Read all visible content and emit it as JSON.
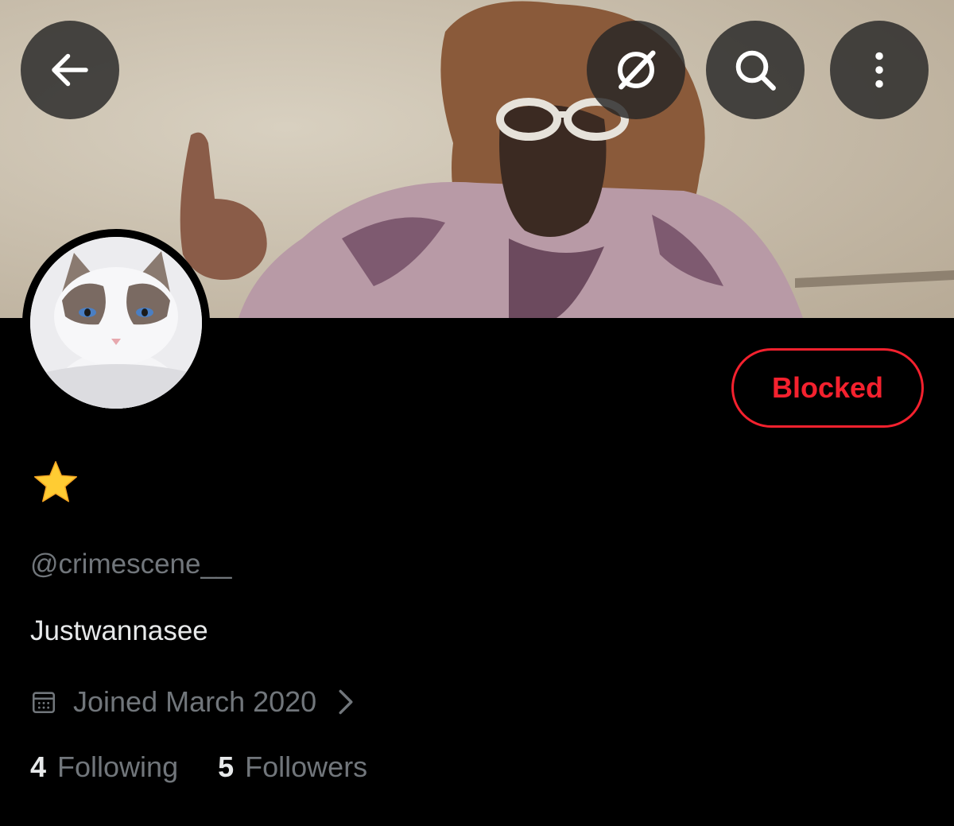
{
  "header": {
    "back_icon": "arrow-left-icon",
    "grok_icon": "grok-icon",
    "search_icon": "search-icon",
    "more_icon": "more-vertical-icon"
  },
  "profile": {
    "display_name_emoji": "⭐",
    "handle": "@crimescene__",
    "bio": "Justwannasee",
    "joined": "Joined March 2020",
    "following_count": "4",
    "following_label": "Following",
    "followers_count": "5",
    "followers_label": "Followers",
    "blocked_label": "Blocked"
  },
  "colors": {
    "background": "#000000",
    "primary_text": "#e7e9ea",
    "secondary_text": "#71767b",
    "blocked_red": "#f4212e"
  }
}
